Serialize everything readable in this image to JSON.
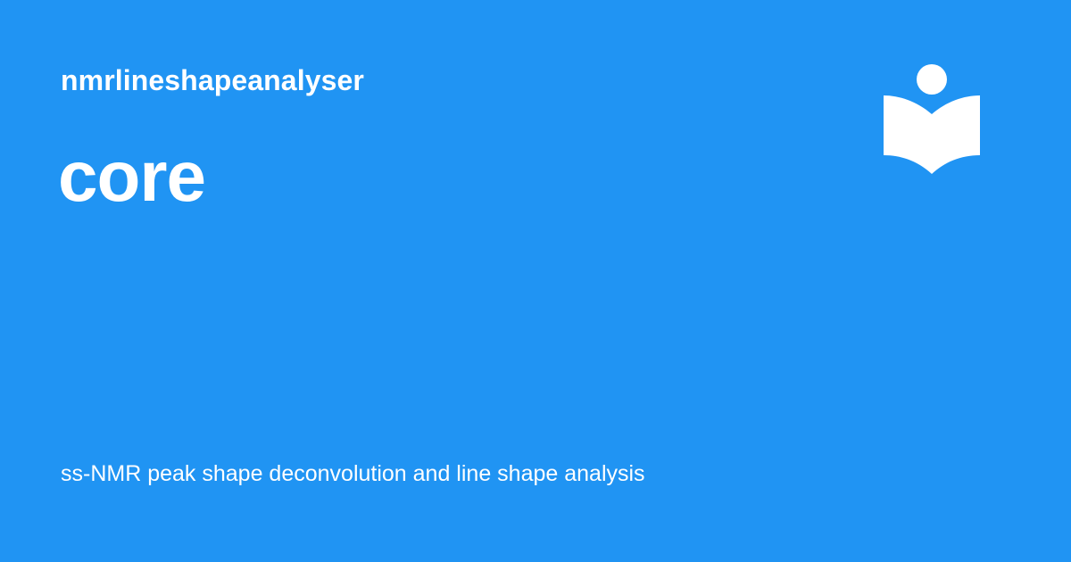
{
  "site": {
    "name": "nmrlineshapeanalyser"
  },
  "page": {
    "title": "core",
    "description": "ss-NMR peak shape deconvolution and line shape analysis"
  },
  "logo": {
    "icon": "reader-book-icon"
  },
  "colors": {
    "background": "#2094f3",
    "foreground": "#ffffff"
  }
}
